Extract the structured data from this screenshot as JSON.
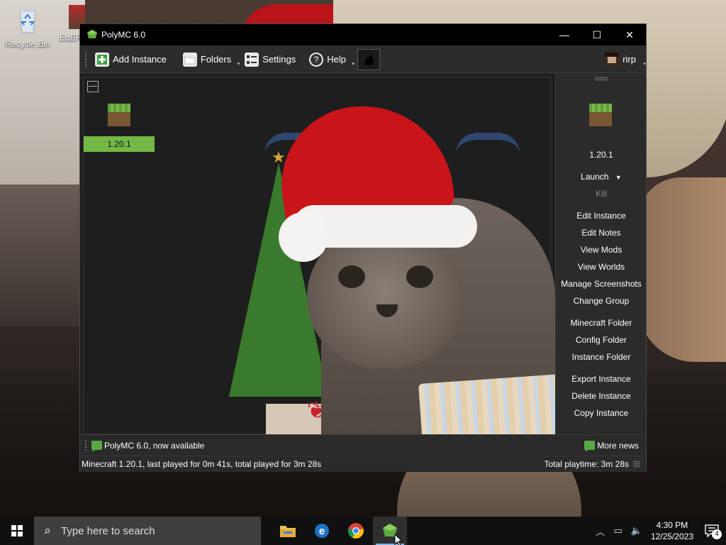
{
  "desktop": {
    "icons": [
      {
        "label": "Recycle Bin"
      },
      {
        "label": "EqER"
      }
    ]
  },
  "window": {
    "title": "PolyMC 6.0",
    "controls": {
      "minimize": "—",
      "maximize": "☐",
      "close": "✕"
    }
  },
  "toolbar": {
    "add_instance": "Add Instance",
    "folders": "Folders",
    "settings": "Settings",
    "help": "Help",
    "account": "rirp"
  },
  "instances": [
    {
      "name": "1.20.1",
      "selected": true
    }
  ],
  "sidebar": {
    "instance_name": "1.20.1",
    "launch": "Launch",
    "kill": "Kill",
    "items_group1": [
      "Edit Instance",
      "Edit Notes",
      "View Mods",
      "View Worlds",
      "Manage Screenshots",
      "Change Group"
    ],
    "items_group2": [
      "Minecraft Folder",
      "Config Folder",
      "Instance Folder"
    ],
    "items_group3": [
      "Export Instance",
      "Delete Instance",
      "Copy Instance"
    ]
  },
  "news": {
    "headline": "PolyMC 6.0, now available",
    "more": "More news"
  },
  "status": {
    "left": "Minecraft 1.20.1, last played for 0m 41s, total played for 3m 28s",
    "right": "Total playtime: 3m 28s"
  },
  "taskbar": {
    "search_placeholder": "Type here to search",
    "time": "4:30 PM",
    "date": "12/25/2023",
    "notification_count": "4"
  },
  "colors": {
    "accent_green": "#74b845",
    "window_bg": "#2a2a2a",
    "titlebar_bg": "#000000"
  }
}
